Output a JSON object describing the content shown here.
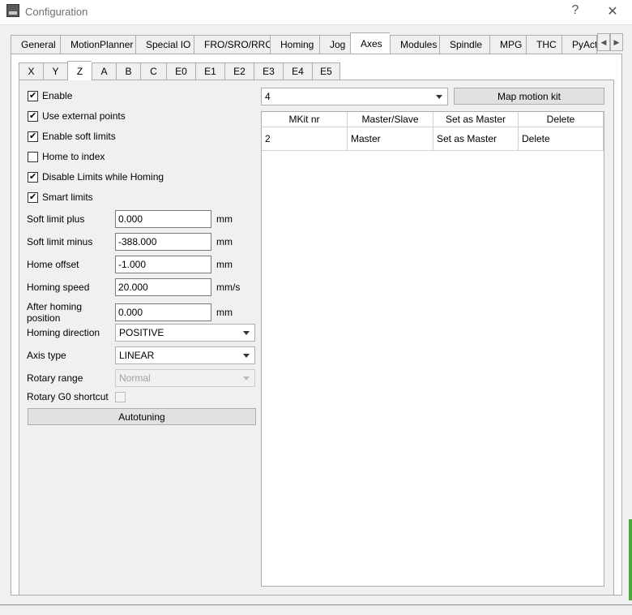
{
  "window": {
    "title": "Configuration",
    "help_label": "?",
    "close_label": "✕"
  },
  "main_tabs": [
    "General",
    "MotionPlanner",
    "Special IO",
    "FRO/SRO/RRO",
    "Homing",
    "Jog",
    "Axes",
    "Modules",
    "Spindle",
    "MPG",
    "THC",
    "PyActio"
  ],
  "active_main_tab": "Axes",
  "sub_tabs": [
    "X",
    "Y",
    "Z",
    "A",
    "B",
    "C",
    "E0",
    "E1",
    "E2",
    "E3",
    "E4",
    "E5"
  ],
  "active_sub_tab": "Z",
  "checkboxes": [
    {
      "label": "Enable",
      "checked": true
    },
    {
      "label": "Use external points",
      "checked": true
    },
    {
      "label": "Enable soft limits",
      "checked": true
    },
    {
      "label": "Home to index",
      "checked": false
    },
    {
      "label": "Disable Limits while Homing",
      "checked": true
    },
    {
      "label": "Smart limits",
      "checked": true
    }
  ],
  "fields": {
    "soft_limit_plus": {
      "label": "Soft limit plus",
      "value": "0.000",
      "unit": "mm"
    },
    "soft_limit_minus": {
      "label": "Soft limit minus",
      "value": "-388.000",
      "unit": "mm"
    },
    "home_offset": {
      "label": "Home offset",
      "value": "-1.000",
      "unit": "mm"
    },
    "homing_speed": {
      "label": "Homing speed",
      "value": "20.000",
      "unit": "mm/s"
    },
    "after_homing_position": {
      "label": "After homing position",
      "value": "0.000",
      "unit": "mm"
    }
  },
  "combos": {
    "homing_direction": {
      "label": "Homing direction",
      "value": "POSITIVE"
    },
    "axis_type": {
      "label": "Axis type",
      "value": "LINEAR"
    },
    "rotary_range": {
      "label": "Rotary range",
      "value": "Normal"
    }
  },
  "rotary_g0": {
    "label": "Rotary G0 shortcut",
    "checked": false
  },
  "autotuning_label": "Autotuning",
  "motion_kit": {
    "selected": "4",
    "map_button_label": "Map motion kit"
  },
  "table": {
    "headers": [
      "MKit nr",
      "Master/Slave",
      "Set as Master",
      "Delete"
    ],
    "rows": [
      {
        "mkit": "2",
        "role": "Master",
        "set_master": "Set as Master",
        "delete": "Delete"
      }
    ]
  }
}
